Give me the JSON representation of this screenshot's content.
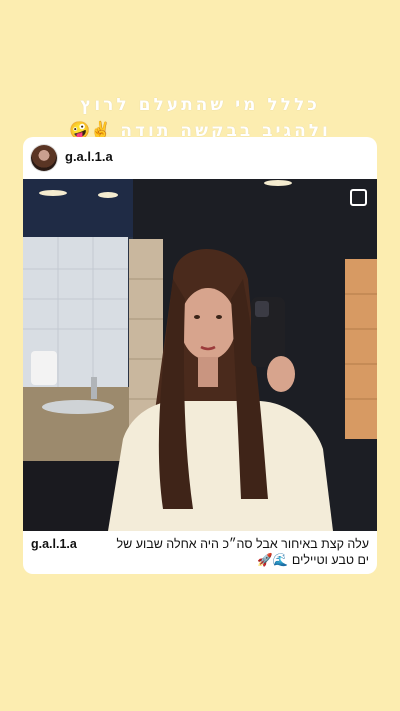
{
  "story": {
    "line1": "כללל מי שהתעלם לרוץ",
    "line2": "ולהגיב בבקשה תודה",
    "line2_emojis": "✌️🤪"
  },
  "post": {
    "username": "g.a.l.1.a",
    "caption_line1": "עלה קצת באיחור אבל סה״כ היה אחלה שבוע של",
    "caption_line2": "ים טבע וטיילים",
    "caption_emojis": "🌊🚀"
  },
  "colors": {
    "background": "#FCEDB0",
    "card": "#FFFFFF"
  }
}
